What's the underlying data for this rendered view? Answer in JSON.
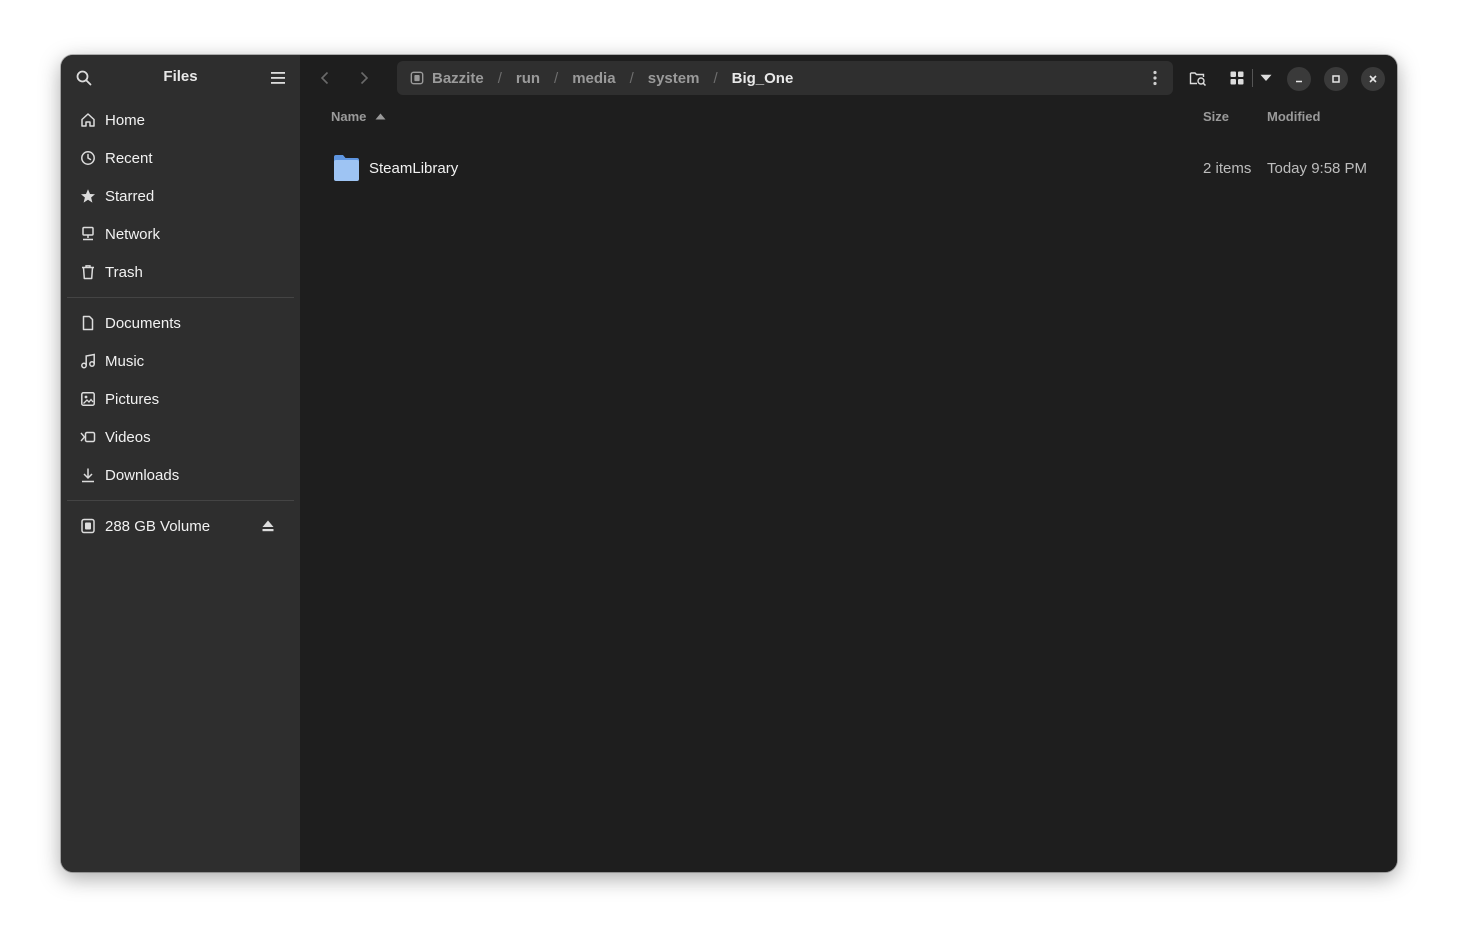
{
  "sidebar": {
    "title": "Files",
    "places": [
      {
        "label": "Home",
        "icon": "home-icon"
      },
      {
        "label": "Recent",
        "icon": "clock-icon"
      },
      {
        "label": "Starred",
        "icon": "star-icon"
      },
      {
        "label": "Network",
        "icon": "network-icon"
      },
      {
        "label": "Trash",
        "icon": "trash-icon"
      }
    ],
    "bookmarks": [
      {
        "label": "Documents",
        "icon": "document-icon"
      },
      {
        "label": "Music",
        "icon": "music-icon"
      },
      {
        "label": "Pictures",
        "icon": "picture-icon"
      },
      {
        "label": "Videos",
        "icon": "video-icon"
      },
      {
        "label": "Downloads",
        "icon": "download-icon"
      }
    ],
    "devices": [
      {
        "label": "288 GB Volume",
        "icon": "drive-icon"
      }
    ]
  },
  "pathbar": {
    "crumbs": [
      "Bazzite",
      "run",
      "media",
      "system",
      "Big_One"
    ],
    "separator": "/"
  },
  "columns": {
    "name": "Name",
    "size": "Size",
    "modified": "Modified"
  },
  "files": [
    {
      "name": "SteamLibrary",
      "size": "2 items",
      "modified": "Today 9:58 PM",
      "icon": "folder-icon"
    }
  ],
  "colors": {
    "window_bg": "#1e1e1e",
    "sidebar_bg": "#2e2e2e",
    "folder": "#8fb8f0"
  }
}
